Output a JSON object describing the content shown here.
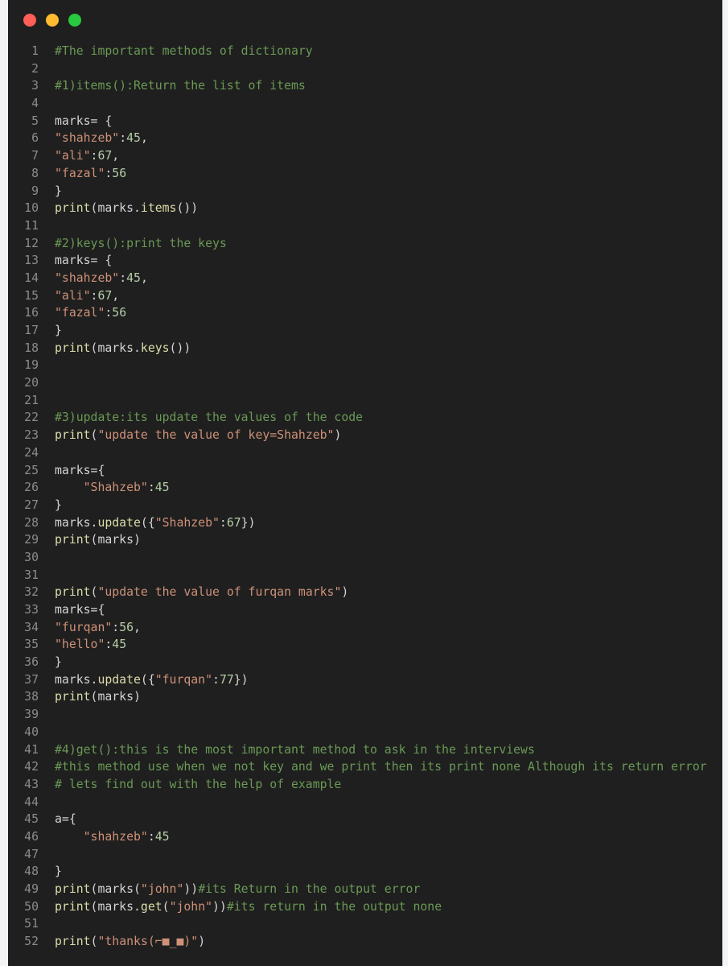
{
  "window": {
    "controls": [
      {
        "name": "close",
        "color": "#ff5f57"
      },
      {
        "name": "minimize",
        "color": "#febc2e"
      },
      {
        "name": "maximize",
        "color": "#28c840"
      }
    ]
  },
  "code_lines": [
    {
      "n": "1",
      "tokens": [
        {
          "t": "comment",
          "v": "#The important methods of dictionary"
        }
      ]
    },
    {
      "n": "2",
      "tokens": []
    },
    {
      "n": "3",
      "tokens": [
        {
          "t": "comment",
          "v": "#1)items():Return the list of items"
        }
      ]
    },
    {
      "n": "4",
      "tokens": []
    },
    {
      "n": "5",
      "tokens": [
        {
          "t": "plain",
          "v": "marks= {"
        }
      ]
    },
    {
      "n": "6",
      "tokens": [
        {
          "t": "string",
          "v": "\"shahzeb\""
        },
        {
          "t": "plain",
          "v": ":"
        },
        {
          "t": "number",
          "v": "45"
        },
        {
          "t": "plain",
          "v": ","
        }
      ]
    },
    {
      "n": "7",
      "tokens": [
        {
          "t": "string",
          "v": "\"ali\""
        },
        {
          "t": "plain",
          "v": ":"
        },
        {
          "t": "number",
          "v": "67"
        },
        {
          "t": "plain",
          "v": ","
        }
      ]
    },
    {
      "n": "8",
      "tokens": [
        {
          "t": "string",
          "v": "\"fazal\""
        },
        {
          "t": "plain",
          "v": ":"
        },
        {
          "t": "number",
          "v": "56"
        }
      ]
    },
    {
      "n": "9",
      "tokens": [
        {
          "t": "plain",
          "v": "}"
        }
      ]
    },
    {
      "n": "10",
      "tokens": [
        {
          "t": "func",
          "v": "print"
        },
        {
          "t": "plain",
          "v": "(marks."
        },
        {
          "t": "func",
          "v": "items"
        },
        {
          "t": "plain",
          "v": "())"
        }
      ]
    },
    {
      "n": "11",
      "tokens": []
    },
    {
      "n": "12",
      "tokens": [
        {
          "t": "comment",
          "v": "#2)keys():print the keys"
        }
      ]
    },
    {
      "n": "13",
      "tokens": [
        {
          "t": "plain",
          "v": "marks= {"
        }
      ]
    },
    {
      "n": "14",
      "tokens": [
        {
          "t": "string",
          "v": "\"shahzeb\""
        },
        {
          "t": "plain",
          "v": ":"
        },
        {
          "t": "number",
          "v": "45"
        },
        {
          "t": "plain",
          "v": ","
        }
      ]
    },
    {
      "n": "15",
      "tokens": [
        {
          "t": "string",
          "v": "\"ali\""
        },
        {
          "t": "plain",
          "v": ":"
        },
        {
          "t": "number",
          "v": "67"
        },
        {
          "t": "plain",
          "v": ","
        }
      ]
    },
    {
      "n": "16",
      "tokens": [
        {
          "t": "string",
          "v": "\"fazal\""
        },
        {
          "t": "plain",
          "v": ":"
        },
        {
          "t": "number",
          "v": "56"
        }
      ]
    },
    {
      "n": "17",
      "tokens": [
        {
          "t": "plain",
          "v": "}"
        }
      ]
    },
    {
      "n": "18",
      "tokens": [
        {
          "t": "func",
          "v": "print"
        },
        {
          "t": "plain",
          "v": "(marks."
        },
        {
          "t": "func",
          "v": "keys"
        },
        {
          "t": "plain",
          "v": "())"
        }
      ]
    },
    {
      "n": "19",
      "tokens": []
    },
    {
      "n": "20",
      "tokens": []
    },
    {
      "n": "21",
      "tokens": []
    },
    {
      "n": "22",
      "tokens": [
        {
          "t": "comment",
          "v": "#3)update:its update the values of the code"
        }
      ]
    },
    {
      "n": "23",
      "tokens": [
        {
          "t": "func",
          "v": "print"
        },
        {
          "t": "plain",
          "v": "("
        },
        {
          "t": "string",
          "v": "\"update the value of key=Shahzeb\""
        },
        {
          "t": "plain",
          "v": ")"
        }
      ]
    },
    {
      "n": "24",
      "tokens": []
    },
    {
      "n": "25",
      "tokens": [
        {
          "t": "plain",
          "v": "marks={"
        }
      ]
    },
    {
      "n": "26",
      "tokens": [
        {
          "t": "plain",
          "v": "    "
        },
        {
          "t": "string",
          "v": "\"Shahzeb\""
        },
        {
          "t": "plain",
          "v": ":"
        },
        {
          "t": "number",
          "v": "45"
        }
      ]
    },
    {
      "n": "27",
      "tokens": [
        {
          "t": "plain",
          "v": "}"
        }
      ]
    },
    {
      "n": "28",
      "tokens": [
        {
          "t": "plain",
          "v": "marks."
        },
        {
          "t": "func",
          "v": "update"
        },
        {
          "t": "plain",
          "v": "({"
        },
        {
          "t": "string",
          "v": "\"Shahzeb\""
        },
        {
          "t": "plain",
          "v": ":"
        },
        {
          "t": "number",
          "v": "67"
        },
        {
          "t": "plain",
          "v": "})"
        }
      ]
    },
    {
      "n": "29",
      "tokens": [
        {
          "t": "func",
          "v": "print"
        },
        {
          "t": "plain",
          "v": "(marks)"
        }
      ]
    },
    {
      "n": "30",
      "tokens": []
    },
    {
      "n": "31",
      "tokens": []
    },
    {
      "n": "32",
      "tokens": [
        {
          "t": "func",
          "v": "print"
        },
        {
          "t": "plain",
          "v": "("
        },
        {
          "t": "string",
          "v": "\"update the value of furqan marks\""
        },
        {
          "t": "plain",
          "v": ")"
        }
      ]
    },
    {
      "n": "33",
      "tokens": [
        {
          "t": "plain",
          "v": "marks={"
        }
      ]
    },
    {
      "n": "34",
      "tokens": [
        {
          "t": "string",
          "v": "\"furqan\""
        },
        {
          "t": "plain",
          "v": ":"
        },
        {
          "t": "number",
          "v": "56"
        },
        {
          "t": "plain",
          "v": ","
        }
      ]
    },
    {
      "n": "35",
      "tokens": [
        {
          "t": "string",
          "v": "\"hello\""
        },
        {
          "t": "plain",
          "v": ":"
        },
        {
          "t": "number",
          "v": "45"
        }
      ]
    },
    {
      "n": "36",
      "tokens": [
        {
          "t": "plain",
          "v": "}"
        }
      ]
    },
    {
      "n": "37",
      "tokens": [
        {
          "t": "plain",
          "v": "marks."
        },
        {
          "t": "func",
          "v": "update"
        },
        {
          "t": "plain",
          "v": "({"
        },
        {
          "t": "string",
          "v": "\"furqan\""
        },
        {
          "t": "plain",
          "v": ":"
        },
        {
          "t": "number",
          "v": "77"
        },
        {
          "t": "plain",
          "v": "})"
        }
      ]
    },
    {
      "n": "38",
      "tokens": [
        {
          "t": "func",
          "v": "print"
        },
        {
          "t": "plain",
          "v": "(marks)"
        }
      ]
    },
    {
      "n": "39",
      "tokens": []
    },
    {
      "n": "40",
      "tokens": []
    },
    {
      "n": "41",
      "tokens": [
        {
          "t": "comment",
          "v": "#4)get():this is the most important method to ask in the interviews"
        }
      ]
    },
    {
      "n": "42",
      "tokens": [
        {
          "t": "comment",
          "v": "#this method use when we not key and we print then its print none Although its return error"
        }
      ]
    },
    {
      "n": "43",
      "tokens": [
        {
          "t": "comment",
          "v": "# lets find out with the help of example"
        }
      ]
    },
    {
      "n": "44",
      "tokens": []
    },
    {
      "n": "45",
      "tokens": [
        {
          "t": "plain",
          "v": "a={"
        }
      ]
    },
    {
      "n": "46",
      "tokens": [
        {
          "t": "plain",
          "v": "    "
        },
        {
          "t": "string",
          "v": "\"shahzeb\""
        },
        {
          "t": "plain",
          "v": ":"
        },
        {
          "t": "number",
          "v": "45"
        }
      ]
    },
    {
      "n": "47",
      "tokens": []
    },
    {
      "n": "48",
      "tokens": [
        {
          "t": "plain",
          "v": "}"
        }
      ]
    },
    {
      "n": "49",
      "tokens": [
        {
          "t": "func",
          "v": "print"
        },
        {
          "t": "plain",
          "v": "(marks("
        },
        {
          "t": "string",
          "v": "\"john\""
        },
        {
          "t": "plain",
          "v": "))"
        },
        {
          "t": "comment",
          "v": "#its Return in the output error"
        }
      ]
    },
    {
      "n": "50",
      "tokens": [
        {
          "t": "func",
          "v": "print"
        },
        {
          "t": "plain",
          "v": "(marks."
        },
        {
          "t": "func",
          "v": "get"
        },
        {
          "t": "plain",
          "v": "("
        },
        {
          "t": "string",
          "v": "\"john\""
        },
        {
          "t": "plain",
          "v": "))"
        },
        {
          "t": "comment",
          "v": "#its return in the output none"
        }
      ]
    },
    {
      "n": "51",
      "tokens": []
    },
    {
      "n": "52",
      "tokens": [
        {
          "t": "func",
          "v": "print"
        },
        {
          "t": "plain",
          "v": "("
        },
        {
          "t": "string",
          "v": "\"thanks(⌐■_■)\""
        },
        {
          "t": "plain",
          "v": ")"
        }
      ]
    }
  ]
}
